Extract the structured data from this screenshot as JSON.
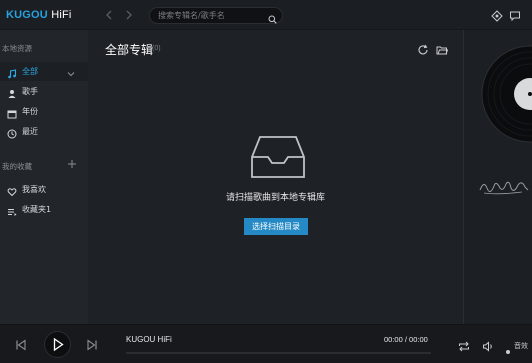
{
  "app": {
    "logo_main": "KUGOU ",
    "logo_sub": "HiFi"
  },
  "search": {
    "placeholder": "搜索专辑名/歌手名"
  },
  "sidebar": {
    "local_title": "本地资源",
    "items": [
      {
        "label": "全部",
        "icon": "music-note-icon"
      },
      {
        "label": "歌手",
        "icon": "person-icon"
      },
      {
        "label": "年份",
        "icon": "calendar-icon"
      },
      {
        "label": "最近",
        "icon": "clock-icon"
      }
    ],
    "collection_title": "我的收藏",
    "collections": [
      {
        "label": "我喜欢",
        "icon": "heart-icon"
      },
      {
        "label": "收藏夹1",
        "icon": "playlist-icon"
      }
    ]
  },
  "main": {
    "title": "全部专辑",
    "count": "(0)",
    "empty_message": "请扫描歌曲到本地专辑库",
    "scan_button": "选择扫描目录"
  },
  "player": {
    "track_title": "KUGOU HiFi",
    "time": "00:00 / 00:00",
    "sound_label": "音效",
    "progress": 0
  },
  "colors": {
    "accent": "#2ca9e7",
    "button": "#2489c4"
  }
}
